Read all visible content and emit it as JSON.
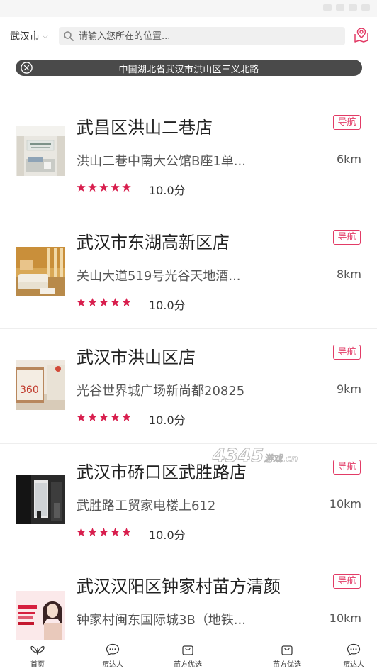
{
  "header": {
    "city": "武汉市",
    "search_placeholder": "请输入您所在的位置...",
    "current_address": "中国湖北省武汉市洪山区三义北路"
  },
  "colors": {
    "accent": "#e23b66",
    "star": "#d81e4d",
    "address_bar": "#4a4a4a"
  },
  "stores": [
    {
      "name": "武昌区洪山二巷店",
      "address": "洪山二巷中南大公馆B座1单...",
      "distance": "6km",
      "rating": 5,
      "score": "10.0分",
      "nav_label": "导航"
    },
    {
      "name": "武汉市东湖高新区店",
      "address": "关山大道519号光谷天地酒...",
      "distance": "8km",
      "rating": 5,
      "score": "10.0分",
      "nav_label": "导航"
    },
    {
      "name": "武汉市洪山区店",
      "address": "光谷世界城广场新尚都20825",
      "distance": "9km",
      "rating": 5,
      "score": "10.0分",
      "nav_label": "导航"
    },
    {
      "name": "武汉市硚口区武胜路店",
      "address": "武胜路工贸家电楼上612",
      "distance": "10km",
      "rating": 5,
      "score": "10.0分",
      "nav_label": "导航"
    },
    {
      "name": "武汉汉阳区钟家村苗方清颜",
      "address": "钟家村闽东国际城3B（地铁...",
      "distance": "10km",
      "rating": 5,
      "score": "10.0分",
      "nav_label": "导航"
    }
  ],
  "watermark": {
    "main": "4345",
    "suffix": "游戏",
    "domain": ".cn"
  },
  "tabs": [
    {
      "label": "首页",
      "icon": "butterfly-icon"
    },
    {
      "label": "痘达人",
      "icon": "chat-icon"
    },
    {
      "label": "苗方优选",
      "icon": "bag-icon"
    },
    {
      "label": "苗方优选",
      "icon": "bag-icon"
    },
    {
      "label": "痘达人",
      "icon": "chat-icon"
    }
  ]
}
